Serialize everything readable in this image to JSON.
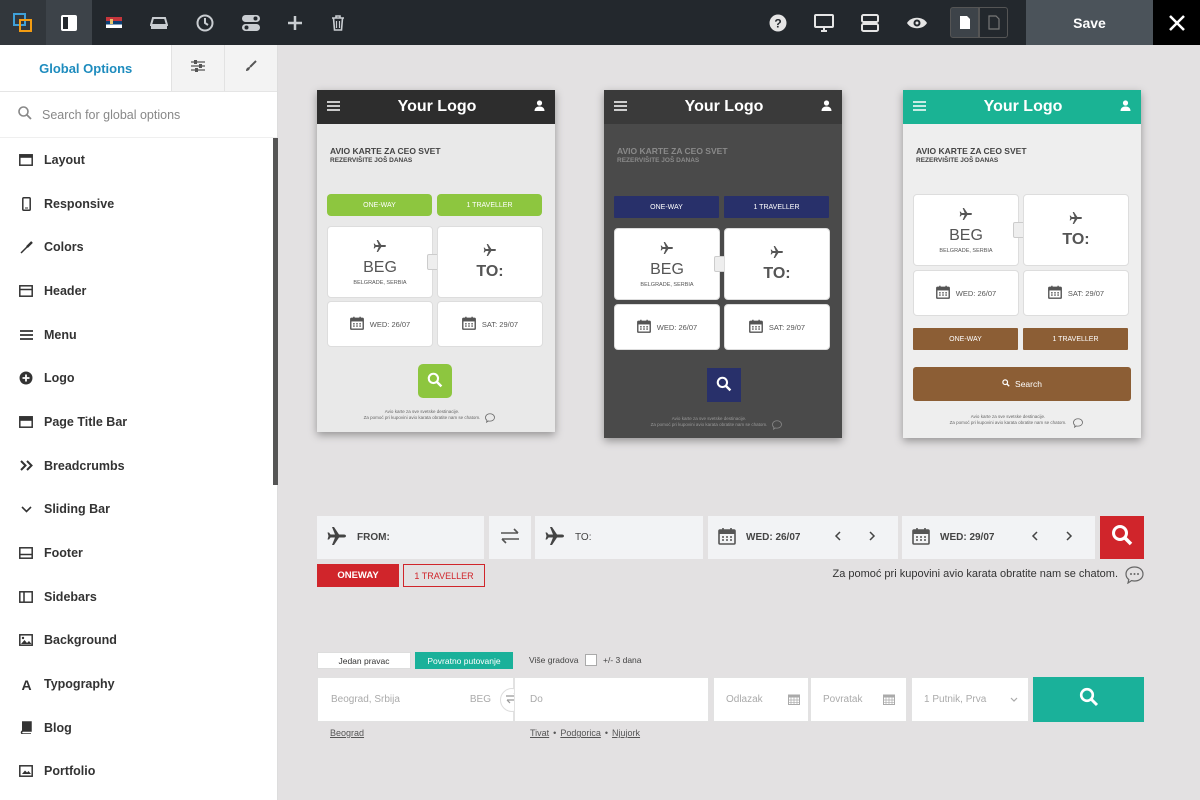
{
  "toolbar": {
    "icons": [
      "fusion-logo-icon",
      "sidebar-panel-icon",
      "serbia-flag-icon",
      "drive-icon",
      "history-icon",
      "toggles-icon",
      "plus-icon",
      "trash-icon"
    ],
    "right_icons": [
      "help-icon",
      "desktop-icon",
      "layout-icon",
      "eye-icon",
      "page-icon",
      "page-outline-icon"
    ],
    "save_label": "Save"
  },
  "sidebar": {
    "tabs": {
      "global": "Global Options"
    },
    "search_placeholder": "Search for global options",
    "items": [
      {
        "label": "Layout",
        "icon": "layout-icon"
      },
      {
        "label": "Responsive",
        "icon": "mobile-icon"
      },
      {
        "label": "Colors",
        "icon": "eyedropper-icon"
      },
      {
        "label": "Header",
        "icon": "header-icon"
      },
      {
        "label": "Menu",
        "icon": "menu-icon"
      },
      {
        "label": "Logo",
        "icon": "plus-circle-icon"
      },
      {
        "label": "Page Title Bar",
        "icon": "title-bar-icon"
      },
      {
        "label": "Breadcrumbs",
        "icon": "double-chevron-icon"
      },
      {
        "label": "Sliding Bar",
        "icon": "chevron-down-icon"
      },
      {
        "label": "Footer",
        "icon": "footer-icon"
      },
      {
        "label": "Sidebars",
        "icon": "sidebars-icon"
      },
      {
        "label": "Background",
        "icon": "image-icon"
      },
      {
        "label": "Typography",
        "icon": "typography-icon"
      },
      {
        "label": "Blog",
        "icon": "book-icon"
      },
      {
        "label": "Portfolio",
        "icon": "portfolio-icon"
      }
    ]
  },
  "phones": [
    {
      "logo": "Your Logo",
      "title": "AVIO KARTE ZA CEO SVET",
      "subtitle": "REZERVIŠITE JOŠ DANAS",
      "oneway": "ONE-WAY",
      "traveller": "1 TRAVELLER",
      "from_code": "BEG",
      "from_city": "BELGRADE, SERBIA",
      "to": "TO:",
      "date1": "WED: 26/07",
      "date2": "SAT: 29/07",
      "footer1": "Avio karte za sve svetske destinacije.",
      "footer2": "Za pomoć pri kupovini avio karata obratite nam se chatom.",
      "colors": {
        "header": "#2d2d2d",
        "body": "#e9e9e9",
        "button": "#8dc63f",
        "text": "#444444"
      }
    },
    {
      "logo": "Your Logo",
      "title": "AVIO KARTE ZA CEO SVET",
      "subtitle": "REZERVIŠITE JOŠ DANAS",
      "oneway": "ONE-WAY",
      "traveller": "1 TRAVELLER",
      "from_code": "BEG",
      "from_city": "BELGRADE, SERBIA",
      "to": "TO:",
      "date1": "WED: 26/07",
      "date2": "SAT: 29/07",
      "footer1": "Avio karte za sve svetske destinacije.",
      "footer2": "Za pomoć pri kupovini avio karata obratite nam se chatom.",
      "colors": {
        "header": "#3a3a3a",
        "body": "#4a4a4a",
        "button": "#28306a",
        "text": "#8a8a8a"
      }
    },
    {
      "logo": "Your Logo",
      "title": "AVIO KARTE ZA CEO SVET",
      "subtitle": "REZERVIŠITE JOŠ DANAS",
      "oneway": "ONE-WAY",
      "traveller": "1 TRAVELLER",
      "from_code": "BEG",
      "from_city": "BELGRADE, SERBIA",
      "to": "TO:",
      "date1": "WED: 26/07",
      "date2": "SAT: 29/07",
      "search": "Search",
      "footer1": "Avio karte za sve svetske destinacije.",
      "footer2": "Za pomoć pri kupovini avio karata obratite nam se chatom.",
      "colors": {
        "header": "#1ab394",
        "body": "#eeeeee",
        "button": "#8c5e35",
        "text": "#444444"
      }
    }
  ],
  "bar1": {
    "from": "FROM:",
    "to": "TO:",
    "date1": "WED: 26/07",
    "date2": "WED: 29/07",
    "oneway": "ONEWAY",
    "traveller": "1 TRAVELLER",
    "help": "Za pomoć pri kupovini avio karata obratite nam se chatom.",
    "accent": "#d0252b"
  },
  "bar2": {
    "tab1": "Jedan pravac",
    "tab2": "Povratno putovanje",
    "multi": "Više gradova",
    "plusminus": "+/- 3 dana",
    "from_placeholder": "Beograd, Srbija",
    "from_code": "BEG",
    "to_placeholder": "Do",
    "depart": "Odlazak",
    "return": "Povratak",
    "passengers": "1 Putnik, Prva",
    "link_from": "Beograd",
    "links_to": [
      "Tivat",
      "Podgorica",
      "Njujork"
    ],
    "bullet": "•",
    "accent": "#1ab19a"
  }
}
